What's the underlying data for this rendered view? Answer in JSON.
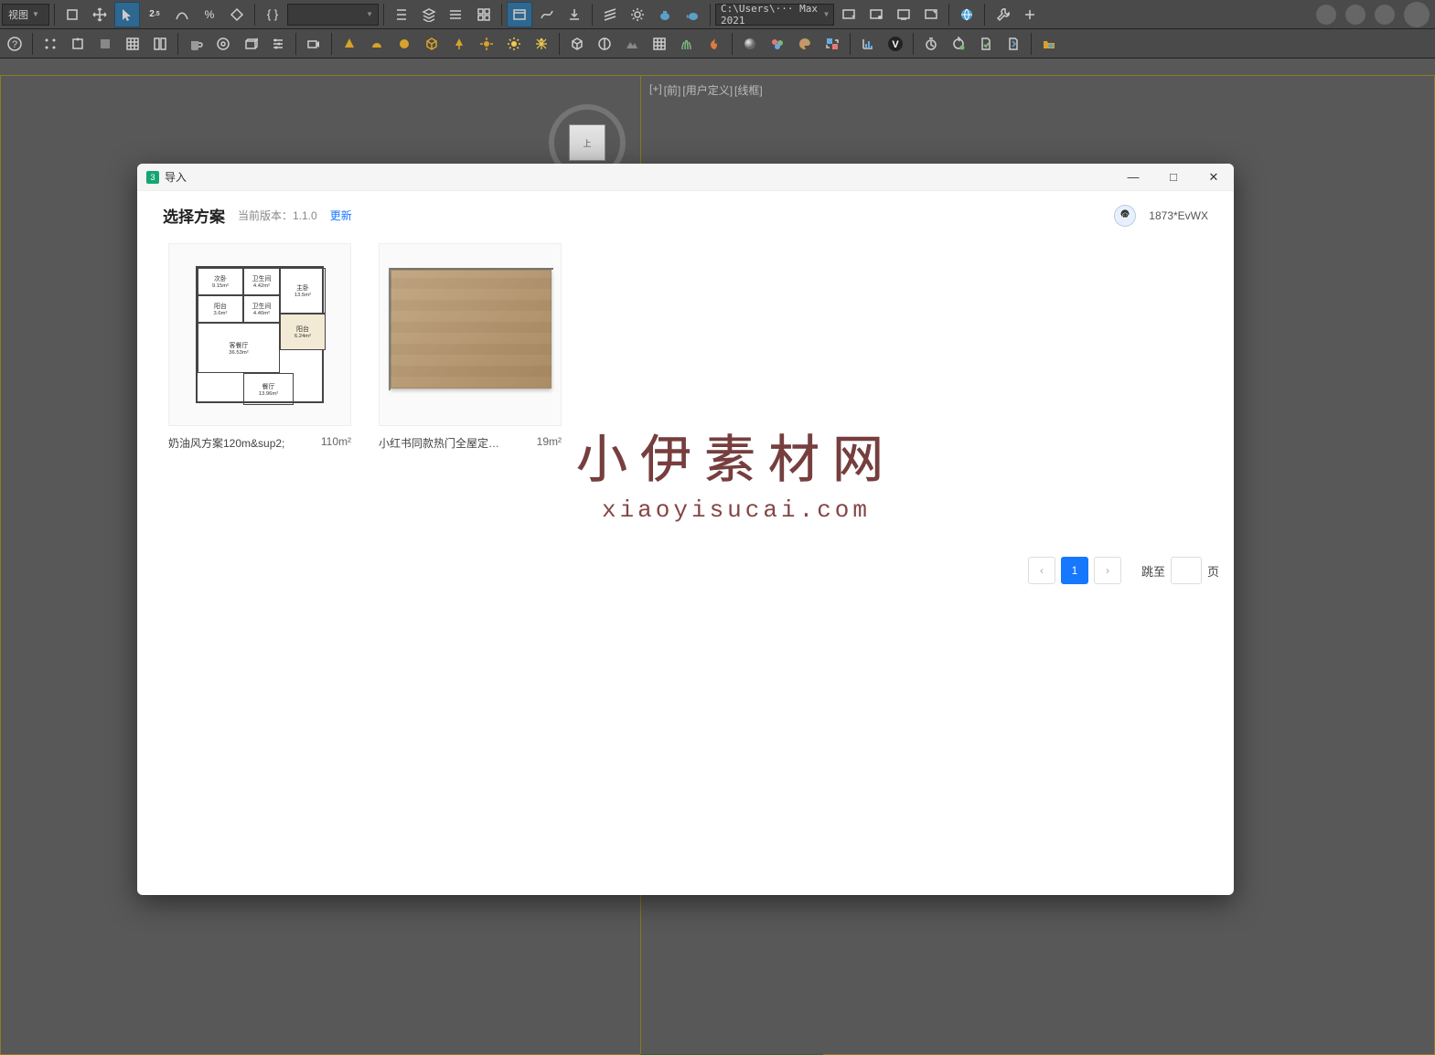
{
  "app": {
    "toolbar1": {
      "view_dropdown": "视图",
      "search_value": "",
      "path": "C:\\Users\\··· Max 2021"
    },
    "viewport": {
      "labels": [
        "[+]",
        "[前]",
        "[用户定义]",
        "[线框]"
      ],
      "cube_face": "上"
    }
  },
  "dialog": {
    "title": "导入",
    "heading": "选择方案",
    "version_label": "当前版本：1.1.0",
    "update_link": "更新",
    "user_id": "1873*EvWX",
    "cards": [
      {
        "name": "奶油风方案120m&sup2;",
        "area": "110m²"
      },
      {
        "name": "小红书同款热门全屋定制案例…",
        "area": "19m²"
      }
    ],
    "floorplan_rooms": [
      {
        "n": "次卧",
        "a": "9.15m²"
      },
      {
        "n": "卫生间",
        "a": "4.42m²"
      },
      {
        "n": "主卧",
        "a": "13.5m²"
      },
      {
        "n": "阳台",
        "a": "3.6m²"
      },
      {
        "n": "卫生间",
        "a": "4.40m²"
      },
      {
        "n": "阳台",
        "a": "6.24m²"
      },
      {
        "n": "客餐厅",
        "a": "36.53m²"
      },
      {
        "n": "餐厅",
        "a": "13.96m²"
      }
    ],
    "pager": {
      "prev": "‹",
      "current": "1",
      "next": "›",
      "jump_label": "跳至",
      "page_suffix": "页"
    }
  },
  "watermark": {
    "cn": "小伊素材网",
    "en": "xiaoyisucai.com"
  }
}
